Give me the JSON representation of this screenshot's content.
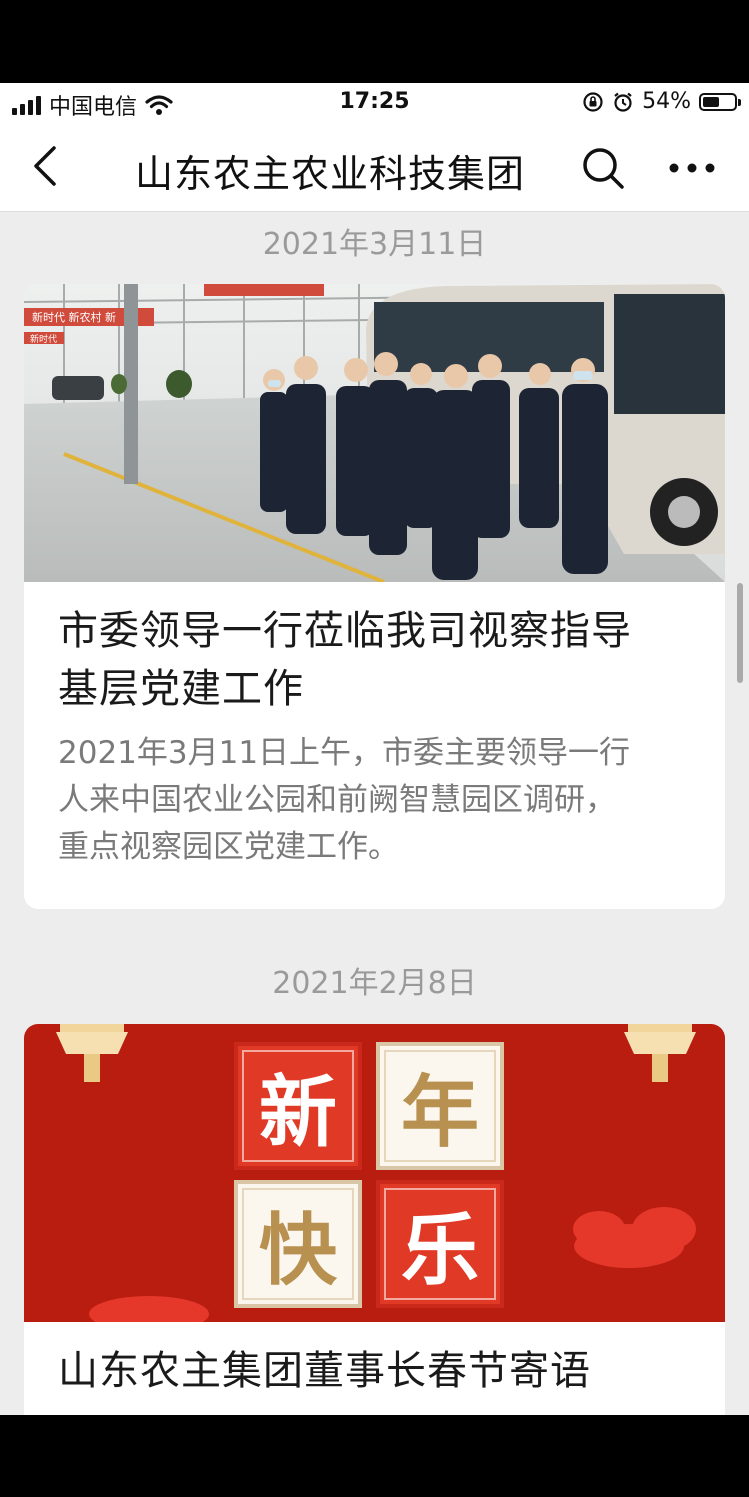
{
  "status_bar": {
    "carrier": "中国电信",
    "time": "17:25",
    "battery_percent": "54%",
    "battery_level": 0.54
  },
  "nav": {
    "title": "山东农主农业科技集团",
    "back_icon": "back-arrow-icon",
    "search_icon": "search-icon",
    "more_icon": "more-dots-icon"
  },
  "feed": [
    {
      "date": "2021年3月11日",
      "title": "市委领导一行莅临我司视察指导基层党建工作",
      "title_lines": [
        "市委领导一行莅临我司视察指导",
        "基层党建工作"
      ],
      "summary_lines": [
        "2021年3月11日上午，市委主要领导一行",
        "人来中国农业公园和前阙智慧园区调研，",
        "重点视察园区党建工作。"
      ],
      "image_banner_texts": [
        "新时代 新农村 新",
        "新时代",
        "新农村"
      ]
    },
    {
      "date": "2021年2月8日",
      "title": "山东农主集团董事长春节寄语",
      "image_chars": [
        "新",
        "年",
        "快",
        "乐"
      ]
    }
  ]
}
